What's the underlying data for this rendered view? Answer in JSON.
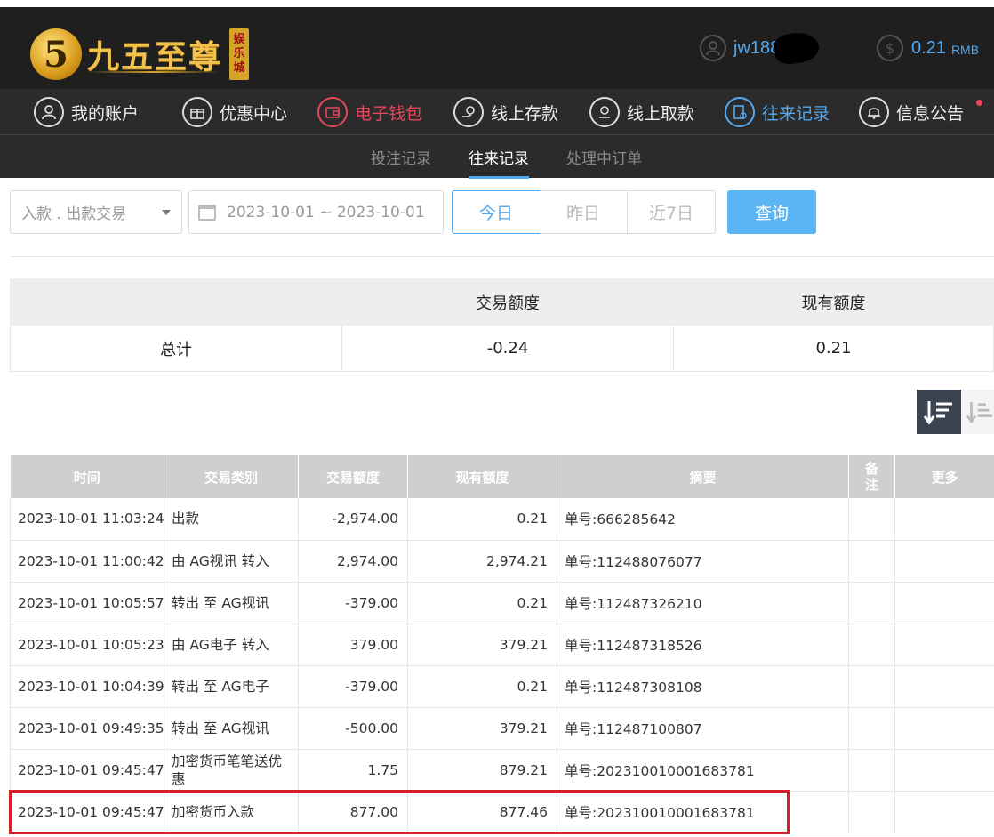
{
  "header": {
    "logo_mark": "5",
    "logo_text": "九五至尊",
    "logo_badge": [
      "娱",
      "乐",
      "城"
    ],
    "username": "jw188",
    "balance": "0.21",
    "currency": "RMB",
    "user_icon": "user-icon",
    "balance_icon": "dollar-coin-icon"
  },
  "nav": {
    "items": [
      {
        "label": "我的账户",
        "icon": "user-icon"
      },
      {
        "label": "优惠中心",
        "icon": "gift-icon"
      },
      {
        "label": "电子钱包",
        "icon": "wallet-icon"
      },
      {
        "label": "线上存款",
        "icon": "deposit-icon"
      },
      {
        "label": "线上取款",
        "icon": "withdraw-icon"
      },
      {
        "label": "往来记录",
        "icon": "records-icon"
      },
      {
        "label": "信息公告",
        "icon": "bell-icon"
      }
    ]
  },
  "subnav": {
    "items": [
      "投注记录",
      "往来记录",
      "处理中订单"
    ],
    "active": "往来记录"
  },
  "filters": {
    "type_select": "入款 . 出款交易",
    "date_range": "2023-10-01 ~ 2023-10-01",
    "periods": [
      "今日",
      "昨日",
      "近7日"
    ],
    "active_period": "今日",
    "query_label": "查询"
  },
  "summary": {
    "headers": [
      "",
      "交易额度",
      "现有额度"
    ],
    "row": [
      "总计",
      "-0.24",
      "0.21"
    ]
  },
  "table": {
    "headers": [
      "时间",
      "交易类别",
      "交易额度",
      "现有额度",
      "摘要",
      "备注",
      "更多"
    ],
    "rows": [
      [
        "2023-10-01 11:03:24",
        "出款",
        "-2,974.00",
        "0.21",
        "单号:666285642",
        "",
        ""
      ],
      [
        "2023-10-01 11:00:42",
        "由 AG视讯 转入",
        "2,974.00",
        "2,974.21",
        "单号:112488076077",
        "",
        ""
      ],
      [
        "2023-10-01 10:05:57",
        "转出 至 AG视讯",
        "-379.00",
        "0.21",
        "单号:112487326210",
        "",
        ""
      ],
      [
        "2023-10-01 10:05:23",
        "由 AG电子 转入",
        "379.00",
        "379.21",
        "单号:112487318526",
        "",
        ""
      ],
      [
        "2023-10-01 10:04:39",
        "转出 至 AG电子",
        "-379.00",
        "0.21",
        "单号:112487308108",
        "",
        ""
      ],
      [
        "2023-10-01 09:49:35",
        "转出 至 AG视讯",
        "-500.00",
        "379.21",
        "单号:112487100807",
        "",
        ""
      ],
      [
        "2023-10-01 09:45:47",
        "加密货币笔笔送优惠",
        "1.75",
        "879.21",
        "单号:202310010001683781",
        "",
        ""
      ],
      [
        "2023-10-01 09:45:47",
        "加密货币入款",
        "877.00",
        "877.46",
        "单号:202310010001683781",
        "",
        ""
      ]
    ]
  },
  "colors": {
    "accent_blue": "#52a8f0",
    "accent_red": "#e8475a",
    "highlight_red": "#d81e2a",
    "header_bg": "#1f1f1f"
  }
}
